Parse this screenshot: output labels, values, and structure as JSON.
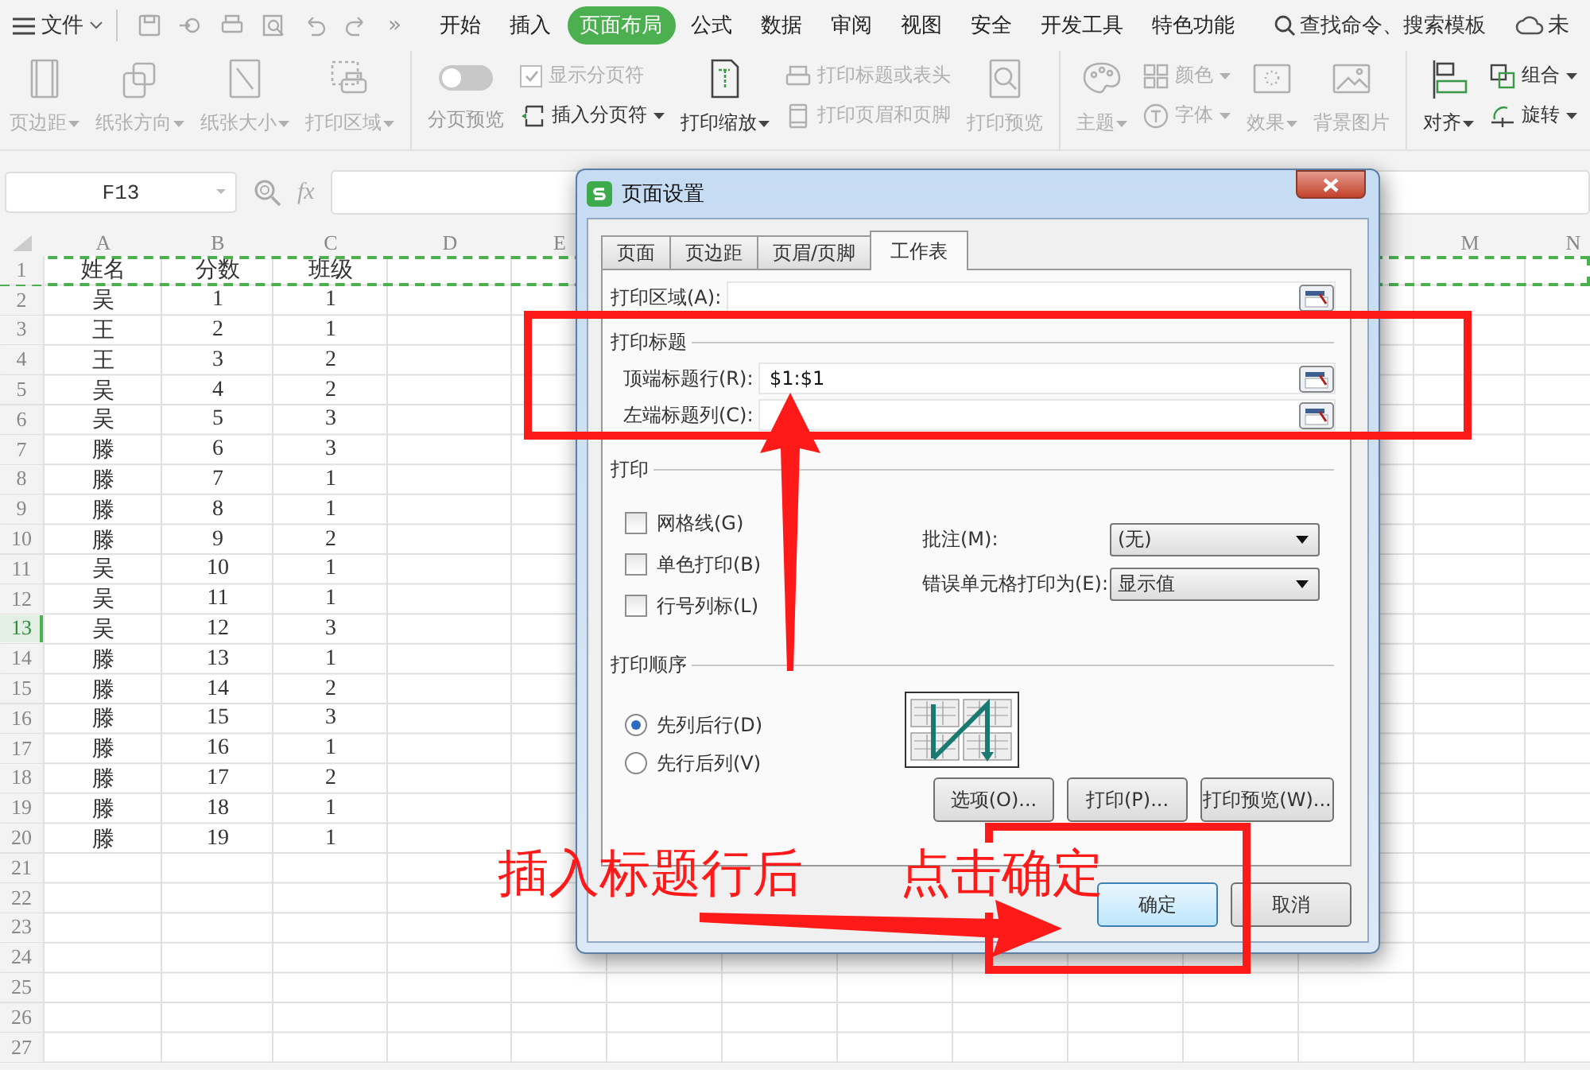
{
  "menu_bar": {
    "file_label": "文件",
    "more": "»",
    "tabs": [
      {
        "label": "开始",
        "selected": false
      },
      {
        "label": "插入",
        "selected": false
      },
      {
        "label": "页面布局",
        "selected": true
      },
      {
        "label": "公式",
        "selected": false
      },
      {
        "label": "数据",
        "selected": false
      },
      {
        "label": "审阅",
        "selected": false
      },
      {
        "label": "视图",
        "selected": false
      },
      {
        "label": "安全",
        "selected": false
      },
      {
        "label": "开发工具",
        "selected": false
      },
      {
        "label": "特色功能",
        "selected": false
      }
    ],
    "search": "查找命令、搜索模板",
    "sync": "未"
  },
  "ribbon": {
    "groups": [
      {
        "items": [
          {
            "kind": "large",
            "label": "页边距",
            "dropdown": true,
            "disabled": true
          },
          {
            "kind": "large",
            "label": "纸张方向",
            "dropdown": true,
            "disabled": true
          },
          {
            "kind": "large",
            "label": "纸张大小",
            "dropdown": true,
            "disabled": true
          },
          {
            "kind": "large",
            "label": "打印区域",
            "dropdown": true,
            "disabled": true
          }
        ]
      },
      {
        "items": [
          {
            "kind": "toggle",
            "label": "分页预览",
            "on": false
          },
          {
            "kind": "stack",
            "items": [
              {
                "kind": "check",
                "label": "显示分页符",
                "checked": true,
                "disabled": true
              },
              {
                "kind": "small",
                "label": "插入分页符",
                "dropdown": true,
                "disabled": false
              }
            ]
          },
          {
            "kind": "large",
            "label": "打印缩放",
            "dropdown": true,
            "disabled": false
          },
          {
            "kind": "stack",
            "items": [
              {
                "kind": "small",
                "label": "打印标题或表头",
                "dropdown": false,
                "disabled": true
              },
              {
                "kind": "small",
                "label": "打印页眉和页脚",
                "dropdown": false,
                "disabled": true
              }
            ]
          },
          {
            "kind": "large",
            "label": "打印预览",
            "dropdown": false,
            "disabled": true
          }
        ]
      },
      {
        "items": [
          {
            "kind": "large",
            "label": "主题",
            "dropdown": true,
            "disabled": true
          },
          {
            "kind": "stack",
            "items": [
              {
                "kind": "small",
                "label": "颜色",
                "dropdown": true,
                "disabled": true
              },
              {
                "kind": "small",
                "label": "字体",
                "dropdown": true,
                "disabled": true
              }
            ]
          },
          {
            "kind": "large",
            "label": "效果",
            "dropdown": true,
            "disabled": true
          },
          {
            "kind": "large",
            "label": "背景图片",
            "dropdown": false,
            "disabled": true
          }
        ]
      },
      {
        "items": [
          {
            "kind": "large",
            "label": "对齐",
            "dropdown": true,
            "disabled": false
          },
          {
            "kind": "stack",
            "items": [
              {
                "kind": "small",
                "label": "组合",
                "dropdown": true,
                "disabled": false
              },
              {
                "kind": "small",
                "label": "旋转",
                "dropdown": true,
                "disabled": false
              }
            ]
          }
        ]
      }
    ]
  },
  "formula_bar": {
    "cell_ref": "F13",
    "fx": "fx"
  },
  "sheet": {
    "columns": [
      {
        "label": "A"
      },
      {
        "label": "B"
      },
      {
        "label": "C"
      },
      {
        "label": "D"
      },
      {
        "label": "E"
      },
      {
        "label": "M"
      },
      {
        "label": "N"
      }
    ],
    "rows": [
      {
        "number": "1",
        "cells": [
          "姓名",
          "分数",
          "班级"
        ],
        "print_title": true,
        "selected": false
      },
      {
        "number": "2",
        "cells": [
          "吴",
          "1",
          "1"
        ],
        "print_title": false,
        "selected": false
      },
      {
        "number": "3",
        "cells": [
          "王",
          "2",
          "1"
        ],
        "print_title": false,
        "selected": false
      },
      {
        "number": "4",
        "cells": [
          "王",
          "3",
          "2"
        ],
        "print_title": false,
        "selected": false
      },
      {
        "number": "5",
        "cells": [
          "吴",
          "4",
          "2"
        ],
        "print_title": false,
        "selected": false
      },
      {
        "number": "6",
        "cells": [
          "吴",
          "5",
          "3"
        ],
        "print_title": false,
        "selected": false
      },
      {
        "number": "7",
        "cells": [
          "滕",
          "6",
          "3"
        ],
        "print_title": false,
        "selected": false
      },
      {
        "number": "8",
        "cells": [
          "滕",
          "7",
          "1"
        ],
        "print_title": false,
        "selected": false
      },
      {
        "number": "9",
        "cells": [
          "滕",
          "8",
          "1"
        ],
        "print_title": false,
        "selected": false
      },
      {
        "number": "10",
        "cells": [
          "滕",
          "9",
          "2"
        ],
        "print_title": false,
        "selected": false
      },
      {
        "number": "11",
        "cells": [
          "吴",
          "10",
          "1"
        ],
        "print_title": false,
        "selected": false
      },
      {
        "number": "12",
        "cells": [
          "吴",
          "11",
          "1"
        ],
        "print_title": false,
        "selected": false
      },
      {
        "number": "13",
        "cells": [
          "吴",
          "12",
          "3"
        ],
        "print_title": false,
        "selected": true
      },
      {
        "number": "14",
        "cells": [
          "滕",
          "13",
          "1"
        ],
        "print_title": false,
        "selected": false
      },
      {
        "number": "15",
        "cells": [
          "滕",
          "14",
          "2"
        ],
        "print_title": false,
        "selected": false
      },
      {
        "number": "16",
        "cells": [
          "滕",
          "15",
          "3"
        ],
        "print_title": false,
        "selected": false
      },
      {
        "number": "17",
        "cells": [
          "滕",
          "16",
          "1"
        ],
        "print_title": false,
        "selected": false
      },
      {
        "number": "18",
        "cells": [
          "滕",
          "17",
          "2"
        ],
        "print_title": false,
        "selected": false
      },
      {
        "number": "19",
        "cells": [
          "滕",
          "18",
          "1"
        ],
        "print_title": false,
        "selected": false
      },
      {
        "number": "20",
        "cells": [
          "滕",
          "19",
          "1"
        ],
        "print_title": false,
        "selected": false
      },
      {
        "number": "21",
        "print_title": false,
        "selected": false
      },
      {
        "number": "22",
        "print_title": false,
        "selected": false
      },
      {
        "number": "23",
        "print_title": false,
        "selected": false
      },
      {
        "number": "24",
        "print_title": false,
        "selected": false
      },
      {
        "number": "25",
        "print_title": false,
        "selected": false
      },
      {
        "number": "26",
        "print_title": false,
        "selected": false
      },
      {
        "number": "27",
        "print_title": false,
        "selected": false
      }
    ]
  },
  "dialog": {
    "title": "页面设置",
    "tabs": [
      {
        "label": "页面",
        "selected": false
      },
      {
        "label": "页边距",
        "selected": false
      },
      {
        "label": "页眉/页脚",
        "selected": false
      },
      {
        "label": "工作表",
        "selected": true
      }
    ],
    "print_area": {
      "label": "打印区域(A):"
    },
    "print_titles": {
      "heading": "打印标题",
      "rows_label": "顶端标题行(R):",
      "rows_value": "$1:$1",
      "cols_label": "左端标题列(C):"
    },
    "print": {
      "heading": "打印",
      "options": [
        {
          "label": "网格线(G)",
          "checked": false
        },
        {
          "label": "单色打印(B)",
          "checked": false
        },
        {
          "label": "行号列标(L)",
          "checked": false
        }
      ],
      "comments": {
        "label": "批注(M):",
        "value": "(无)"
      },
      "errors": {
        "label": "错误单元格打印为(E):",
        "value": "显示值"
      }
    },
    "order": {
      "heading": "打印顺序",
      "options": [
        {
          "label": "先列后行(D)",
          "selected": true
        },
        {
          "label": "先行后列(V)",
          "selected": false
        }
      ]
    },
    "panel_buttons": [
      "选项(O)...",
      "打印(P)...",
      "打印预览(W)..."
    ],
    "buttons": [
      {
        "label": "确定",
        "default": true
      },
      {
        "label": "取消",
        "default": false
      }
    ]
  },
  "annotation": {
    "texts": [
      "插入标题行后",
      "点击确定"
    ]
  }
}
